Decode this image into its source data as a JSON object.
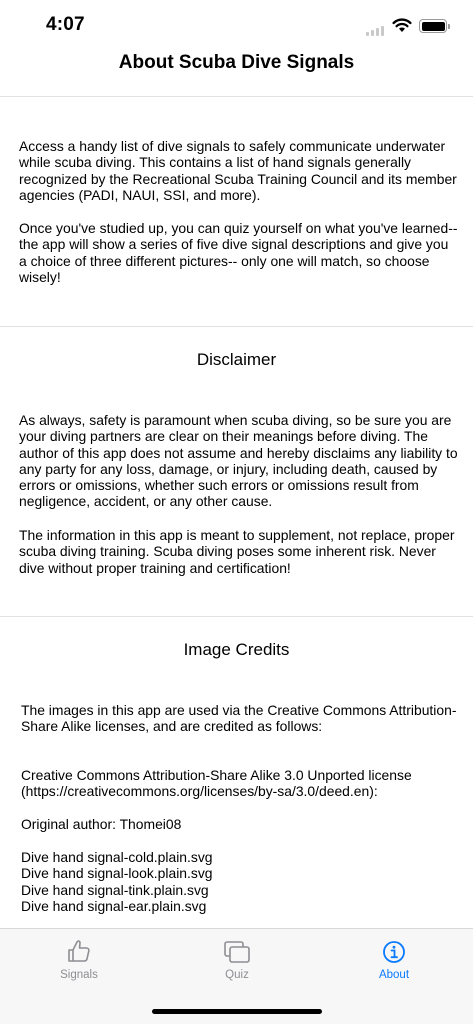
{
  "status_bar": {
    "time": "4:07"
  },
  "nav": {
    "title": "About Scuba Dive Signals"
  },
  "about": {
    "intro": "Access a handy list of dive signals to safely communicate underwater while scuba diving. This contains a list of hand signals generally recognized by the Recreational Scuba Training Council and its member agencies (PADI, NAUI, SSI, and more).",
    "quiz_info": "Once you've studied up, you can quiz yourself on what you've learned-- the app will show a series of five dive signal descriptions and give you a choice of three different pictures-- only one will match, so choose wisely!"
  },
  "disclaimer": {
    "title": "Disclaimer",
    "text1": "As always, safety is paramount when scuba diving, so be sure you are your diving partners are clear on their meanings before diving. The author of this app does not assume and hereby disclaims any liability to any party for any loss, damage, or injury, including death, caused by errors or omissions, whether such errors or omissions result from negligence, accident, or any other cause.",
    "text2": "The information in this app is meant to supplement, not replace, proper scuba diving training. Scuba diving poses some inherent risk. Never dive without proper training and certification!"
  },
  "credits": {
    "title": "Image Credits",
    "intro": "The images in this app are used via the Creative Commons Attribution-Share Alike licenses, and are credited as follows:",
    "license": "Creative Commons Attribution-Share Alike 3.0 Unported license (https://creativecommons.org/licenses/by-sa/3.0/deed.en):",
    "author": "Original author: Thomei08",
    "files": [
      "Dive hand signal-cold.plain.svg",
      "Dive hand signal-look.plain.svg",
      "Dive hand signal-tink.plain.svg",
      "Dive hand signal-ear.plain.svg"
    ]
  },
  "tabs": [
    {
      "label": "Signals",
      "icon": "thumbs-up-icon",
      "active": false
    },
    {
      "label": "Quiz",
      "icon": "cards-icon",
      "active": false
    },
    {
      "label": "About",
      "icon": "info-icon",
      "active": true
    }
  ],
  "colors": {
    "accent": "#0a7aff",
    "inactive": "#8e8e93"
  }
}
